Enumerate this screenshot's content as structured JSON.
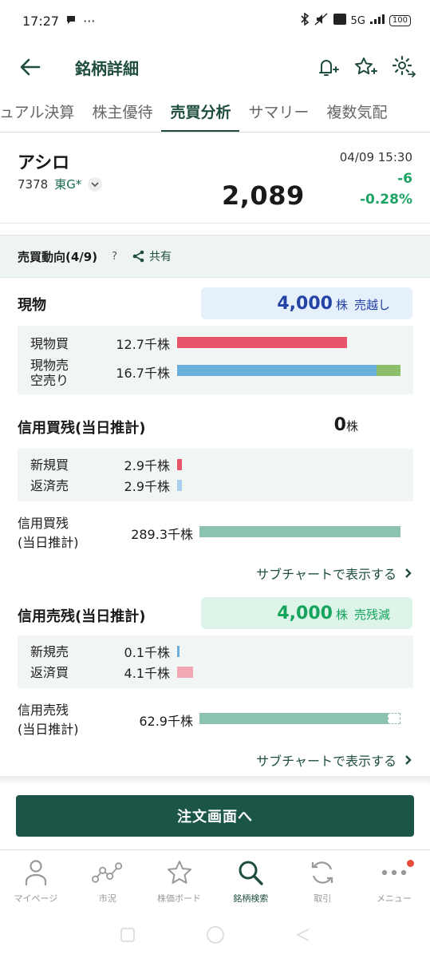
{
  "status_bar": {
    "time": "17:27",
    "indicators": "5G",
    "battery": "100"
  },
  "header": {
    "title": "銘柄詳細"
  },
  "tabs": [
    {
      "label": "ュアル決算"
    },
    {
      "label": "株主優待"
    },
    {
      "label": "売買分析"
    },
    {
      "label": "サマリー"
    },
    {
      "label": "複数気配"
    }
  ],
  "stock": {
    "name": "アシロ",
    "code": "7378",
    "market": "東G*",
    "price": "2,089",
    "timestamp": "04/09 15:30",
    "change": "-6",
    "change_pct": "-0.28%"
  },
  "section": {
    "title": "売買動向(4/9)",
    "help": "?",
    "share": "共有"
  },
  "cash": {
    "title": "現物",
    "net_value": "4,000",
    "net_unit": "株",
    "net_label": "売越し",
    "rows": [
      {
        "label": "現物買",
        "value": "12.7千株"
      },
      {
        "label": "現物売\n空売り",
        "value": "16.7千株"
      }
    ],
    "bar_buy": 12.7,
    "bar_sell": 16.7,
    "bar_sell_cash_part": 14.9,
    "bar_max": 16.7
  },
  "margin_buy": {
    "title": "信用買残(当日推計)",
    "net_value": "0",
    "net_unit": "株",
    "rows": [
      {
        "label": "新規買",
        "value": "2.9千株"
      },
      {
        "label": "返済売",
        "value": "2.9千株"
      }
    ],
    "balance_label": "信用買残\n(当日推計)",
    "balance_value": "289.3千株",
    "link": "サブチャートで表示する"
  },
  "margin_sell": {
    "title": "信用売残(当日推計)",
    "net_value": "4,000",
    "net_unit": "株",
    "net_label": "売残減",
    "rows": [
      {
        "label": "新規売",
        "value": "0.1千株"
      },
      {
        "label": "返済買",
        "value": "4.1千株"
      }
    ],
    "balance_label": "信用売残\n(当日推計)",
    "balance_value": "62.9千株",
    "link": "サブチャートで表示する"
  },
  "order_button": "注文画面へ",
  "bottom_nav": [
    {
      "label": "マイページ",
      "icon": "person-icon"
    },
    {
      "label": "市況",
      "icon": "market-icon"
    },
    {
      "label": "株価ボード",
      "icon": "star-icon"
    },
    {
      "label": "銘柄検索",
      "icon": "search-icon"
    },
    {
      "label": "取引",
      "icon": "trade-icon"
    },
    {
      "label": "メニュー",
      "icon": "more-icon"
    }
  ],
  "colors": {
    "accent": "#1e4d3f",
    "buy_bar": "#e8546a",
    "sell_bar": "#6aaedc",
    "short_bar": "#8dbf6a",
    "balance_bar": "#8cc2b0",
    "down_green": "#1ea364",
    "net_sell_blue": "#2343a5"
  }
}
